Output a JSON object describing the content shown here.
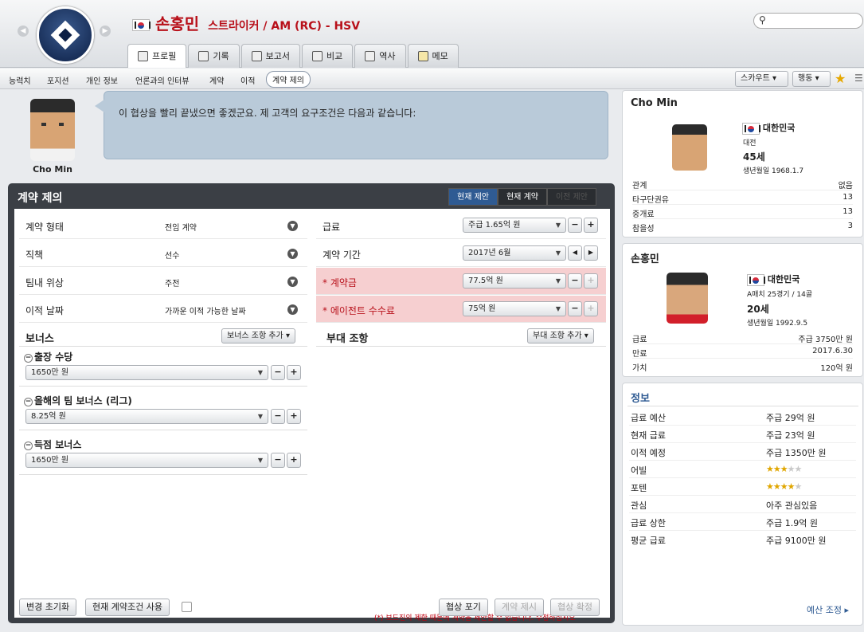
{
  "header": {
    "player_name": "손홍민",
    "position_club": "스트라이커 / AM (RC) - HSV",
    "search_icon": "⚲"
  },
  "tabs": [
    {
      "label": "프로필"
    },
    {
      "label": "기록"
    },
    {
      "label": "보고서"
    },
    {
      "label": "비교"
    },
    {
      "label": "역사"
    },
    {
      "label": "메모"
    }
  ],
  "subnav": {
    "items": [
      "능력치",
      "포지션",
      "개인 정보",
      "언론과의 인터뷰",
      "계약",
      "이적",
      "계약 제의"
    ],
    "scout": "스카우트",
    "action": "행동"
  },
  "agent": {
    "name": "Cho Min",
    "message": "이 협상을 빨리 끝냈으면 좋겠군요. 제 고객의 요구조건은 다음과 같습니다:"
  },
  "offer": {
    "title": "계약 제의",
    "segments": [
      "현재 제안",
      "현재 계약",
      "이전 제안"
    ],
    "left_rows": [
      {
        "label": "계약 형태",
        "value": "전임 계약"
      },
      {
        "label": "직책",
        "value": "선수"
      },
      {
        "label": "팀내 위상",
        "value": "주전"
      },
      {
        "label": "이적 날짜",
        "value": "가까운 이적 가능한 날짜"
      }
    ],
    "right_rows": [
      {
        "label": "급료",
        "value": "주급 1.65억 원",
        "required": false
      },
      {
        "label": "계약 기간",
        "value": "2017년 6월",
        "required": false
      },
      {
        "label": "* 계약금",
        "value": "77.5억 원",
        "required": true
      },
      {
        "label": "* 에이전트 수수료",
        "value": "75억 원",
        "required": true
      }
    ],
    "bonus_title": "보너스",
    "bonus_add": "보너스 조항 추가",
    "clause_title": "부대 조항",
    "clause_add": "부대 조항 추가",
    "bonuses": [
      {
        "label": "출장 수당",
        "value": "1650만 원"
      },
      {
        "label": "올해의 팀 보너스 (리그)",
        "value": "8.25억 원"
      },
      {
        "label": "득점 보너스",
        "value": "1650만 원"
      }
    ],
    "warning": "(*) 보드진의 제한 때문에 계약을 제안할 수 없습니다. 수정하십시오",
    "buttons": {
      "reset": "변경 초기화",
      "use_current": "현재 계약조건 사용",
      "no_negotiate": "협상 불가",
      "give_up": "협상 포기",
      "propose": "계약 제시",
      "confirm": "협상 확정"
    }
  },
  "agent_card": {
    "name": "Cho Min",
    "nation": "대한민국",
    "city": "대전",
    "age": "45세",
    "dob": "생년월일 1968.1.7",
    "rows": [
      {
        "k": "관계",
        "v": "없음"
      },
      {
        "k": "타구단권유",
        "v": "13"
      },
      {
        "k": "중개료",
        "v": "13"
      },
      {
        "k": "참을성",
        "v": "3"
      }
    ]
  },
  "player_card": {
    "name": "손홍민",
    "nation": "대한민국",
    "caps": "A매치 25경기 / 14골",
    "age": "20세",
    "dob": "생년월일 1992.9.5",
    "rows": [
      {
        "k": "급료",
        "v": "주급 3750만 원"
      },
      {
        "k": "만료",
        "v": "2017.6.30"
      },
      {
        "k": "가치",
        "v": "120억 원"
      }
    ]
  },
  "info": {
    "title": "정보",
    "rows": [
      {
        "k": "급료 예산",
        "v": "주급 29억 원"
      },
      {
        "k": "현재 급료",
        "v": "주급 23억 원"
      },
      {
        "k": "이적 예정",
        "v": "주급 1350만 원"
      },
      {
        "k": "관심",
        "v": "아주 관심있음"
      },
      {
        "k": "급료 상한",
        "v": "주급 1.9억 원"
      },
      {
        "k": "평균 급료",
        "v": "주급 9100만 원"
      }
    ],
    "ability_label": "어빌",
    "ability_stars": 3,
    "potential_label": "포텐",
    "potential_stars": 4,
    "max_stars": 5,
    "budget_adjust": "예산 조정"
  },
  "colors": {
    "accent": "#2f5b93",
    "title_red": "#b8101a",
    "warn": "#c0000f",
    "required_bg": "#f6cfd0"
  }
}
